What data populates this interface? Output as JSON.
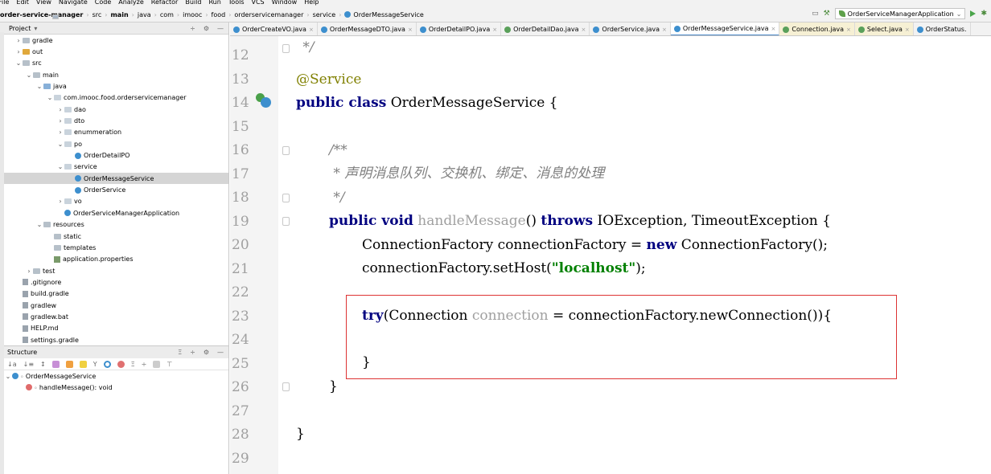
{
  "menu": [
    "File",
    "Edit",
    "View",
    "Navigate",
    "Code",
    "Analyze",
    "Refactor",
    "Build",
    "Run",
    "Tools",
    "VCS",
    "Window",
    "Help"
  ],
  "breadcrumbs": [
    "order-service-manager",
    "src",
    "main",
    "java",
    "com",
    "imooc",
    "food",
    "orderservicemanager",
    "service",
    "OrderMessageService"
  ],
  "run_config": "OrderServiceManagerApplication",
  "project_panel": {
    "title": "Project",
    "tree": [
      {
        "label": "gradle",
        "depth": 1,
        "arrow": ">",
        "icon": "gray"
      },
      {
        "label": "out",
        "depth": 1,
        "arrow": ">",
        "icon": "orange"
      },
      {
        "label": "src",
        "depth": 1,
        "arrow": "v",
        "icon": "gray"
      },
      {
        "label": "main",
        "depth": 2,
        "arrow": "v",
        "icon": "gray"
      },
      {
        "label": "java",
        "depth": 3,
        "arrow": "v",
        "icon": "blue"
      },
      {
        "label": "com.imooc.food.orderservicemanager",
        "depth": 4,
        "arrow": "v",
        "icon": "pkg"
      },
      {
        "label": "dao",
        "depth": 5,
        "arrow": ">",
        "icon": "pkg"
      },
      {
        "label": "dto",
        "depth": 5,
        "arrow": ">",
        "icon": "pkg"
      },
      {
        "label": "enummeration",
        "depth": 5,
        "arrow": ">",
        "icon": "pkg"
      },
      {
        "label": "po",
        "depth": 5,
        "arrow": "v",
        "icon": "pkg"
      },
      {
        "label": "OrderDetailPO",
        "depth": 6,
        "arrow": "",
        "icon": "class"
      },
      {
        "label": "service",
        "depth": 5,
        "arrow": "v",
        "icon": "pkg"
      },
      {
        "label": "OrderMessageService",
        "depth": 6,
        "arrow": "",
        "icon": "class",
        "selected": true
      },
      {
        "label": "OrderService",
        "depth": 6,
        "arrow": "",
        "icon": "class"
      },
      {
        "label": "vo",
        "depth": 5,
        "arrow": ">",
        "icon": "pkg"
      },
      {
        "label": "OrderServiceManagerApplication",
        "depth": 5,
        "arrow": "",
        "icon": "class"
      },
      {
        "label": "resources",
        "depth": 3,
        "arrow": "v",
        "icon": "gray"
      },
      {
        "label": "static",
        "depth": 4,
        "arrow": "",
        "icon": "gray"
      },
      {
        "label": "templates",
        "depth": 4,
        "arrow": "",
        "icon": "gray"
      },
      {
        "label": "application.properties",
        "depth": 4,
        "arrow": "",
        "icon": "green"
      },
      {
        "label": "test",
        "depth": 2,
        "arrow": ">",
        "icon": "gray"
      },
      {
        "label": ".gitignore",
        "depth": 1,
        "arrow": "",
        "icon": "file"
      },
      {
        "label": "build.gradle",
        "depth": 1,
        "arrow": "",
        "icon": "file"
      },
      {
        "label": "gradlew",
        "depth": 1,
        "arrow": "",
        "icon": "file"
      },
      {
        "label": "gradlew.bat",
        "depth": 1,
        "arrow": "",
        "icon": "file"
      },
      {
        "label": "HELP.md",
        "depth": 1,
        "arrow": "",
        "icon": "file"
      },
      {
        "label": "settings.gradle",
        "depth": 1,
        "arrow": "",
        "icon": "file"
      }
    ]
  },
  "structure_panel": {
    "title": "Structure",
    "class_name": "OrderMessageService",
    "method": "handleMessage(): void"
  },
  "tabs": [
    {
      "label": "OrderCreateVO.java",
      "type": "class"
    },
    {
      "label": "OrderMessageDTO.java",
      "type": "class"
    },
    {
      "label": "OrderDetailPO.java",
      "type": "class"
    },
    {
      "label": "OrderDetailDao.java",
      "type": "interface"
    },
    {
      "label": "OrderService.java",
      "type": "class"
    },
    {
      "label": "OrderMessageService.java",
      "type": "class",
      "active": true
    },
    {
      "label": "Connection.java",
      "type": "interface",
      "warn": true
    },
    {
      "label": "Select.java",
      "type": "interface",
      "warn": true
    },
    {
      "label": "OrderStatus.",
      "type": "class"
    }
  ],
  "editor": {
    "line_numbers": [
      "12",
      "13",
      "14",
      "15",
      "16",
      "17",
      "18",
      "19",
      "20",
      "21",
      "22",
      "23",
      "24",
      "25",
      "26",
      "27",
      "28",
      "29"
    ],
    "code": {
      "l12": " */",
      "l13": "@Service",
      "l14_kw": "public class",
      "l14_rest": " OrderMessageService {",
      "l16": "/**",
      "l17": " * 声明消息队列、交换机、绑定、消息的处理",
      "l18": " */",
      "l19_kw1": "public void",
      "l19_m": " handleMessage",
      "l19_p": "() ",
      "l19_kw2": "throws",
      "l19_rest": " IOException, TimeoutException {",
      "l20_a": "ConnectionFactory connectionFactory = ",
      "l20_kw": "new",
      "l20_b": " ConnectionFactory();",
      "l21_a": "connectionFactory.setHost(",
      "l21_str": "\"localhost\"",
      "l21_b": ");",
      "l23_kw": "try",
      "l23_a": "(Connection ",
      "l23_var": "connection",
      "l23_b": " = connectionFactory.newConnection()){",
      "l25": "}",
      "l26": "}",
      "l28": "}"
    }
  }
}
